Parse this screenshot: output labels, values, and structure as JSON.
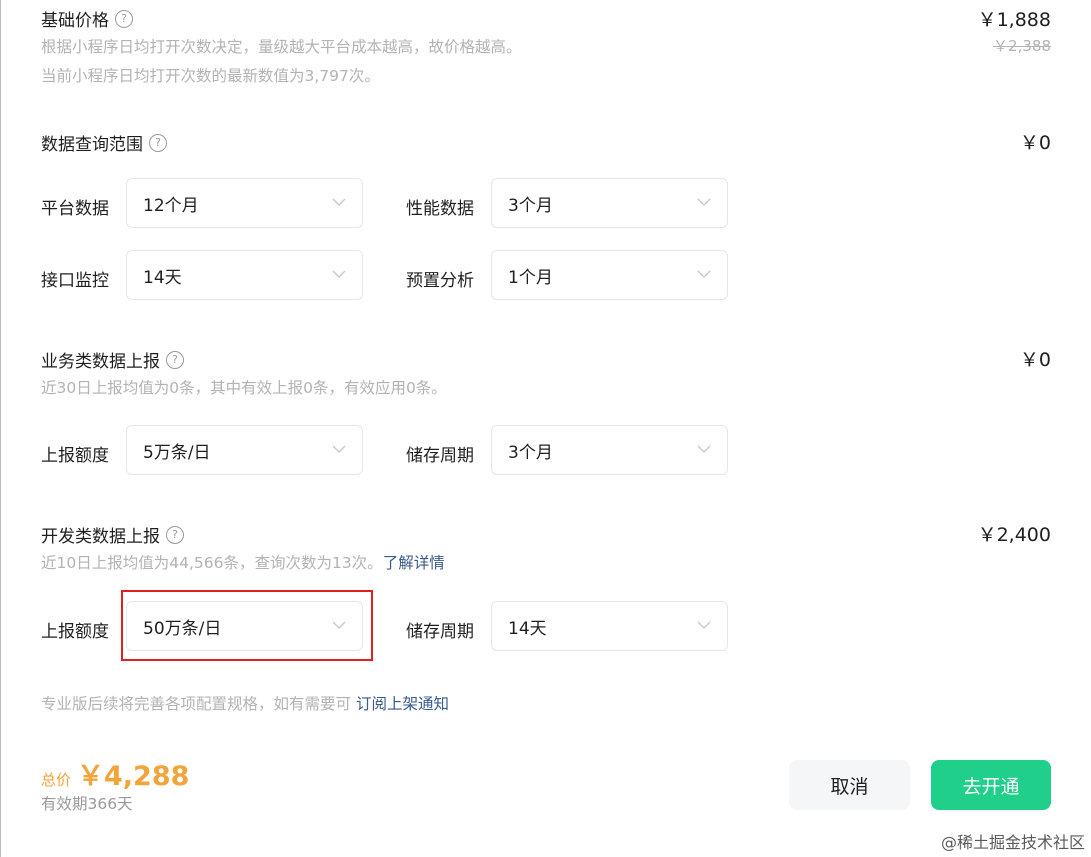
{
  "sections": {
    "base": {
      "title": "基础价格",
      "desc1": "根据小程序日均打开次数决定，量级越大平台成本越高，故价格越高。",
      "desc2": "当前小程序日均打开次数的最新数值为3,797次。",
      "price": "￥1,888",
      "original_price": "￥2,388"
    },
    "query": {
      "title": "数据查询范围",
      "price": "￥0",
      "fields": {
        "platform_label": "平台数据",
        "platform_value": "12个月",
        "performance_label": "性能数据",
        "performance_value": "3个月",
        "api_label": "接口监控",
        "api_value": "14天",
        "preset_label": "预置分析",
        "preset_value": "1个月"
      }
    },
    "business": {
      "title": "业务类数据上报",
      "desc": "近30日上报均值为0条，其中有效上报0条，有效应用0条。",
      "price": "￥0",
      "quota_label": "上报额度",
      "quota_value": "5万条/日",
      "storage_label": "储存周期",
      "storage_value": "3个月"
    },
    "dev": {
      "title": "开发类数据上报",
      "desc": "近10日上报均值为44,566条，查询次数为13次。",
      "desc_link": "了解详情",
      "price": "￥2,400",
      "quota_label": "上报额度",
      "quota_value": "50万条/日",
      "storage_label": "储存周期",
      "storage_value": "14天"
    }
  },
  "notice": {
    "text": "专业版后续将完善各项配置规格，如有需要可 ",
    "link": "订阅上架通知"
  },
  "footer": {
    "total_label": "总价",
    "total_value": "￥4,288",
    "validity": "有效期366天",
    "cancel_label": "取消",
    "open_label": "去开通"
  },
  "watermark": "@稀土掘金技术社区",
  "icons": {
    "help": "question-circle-icon",
    "chevron": "chevron-down-icon"
  },
  "colors": {
    "accent_green": "#1fcf8a",
    "price_orange": "#f2a33a",
    "link_blue": "#3a5a8c",
    "highlight_red": "#e02020"
  }
}
